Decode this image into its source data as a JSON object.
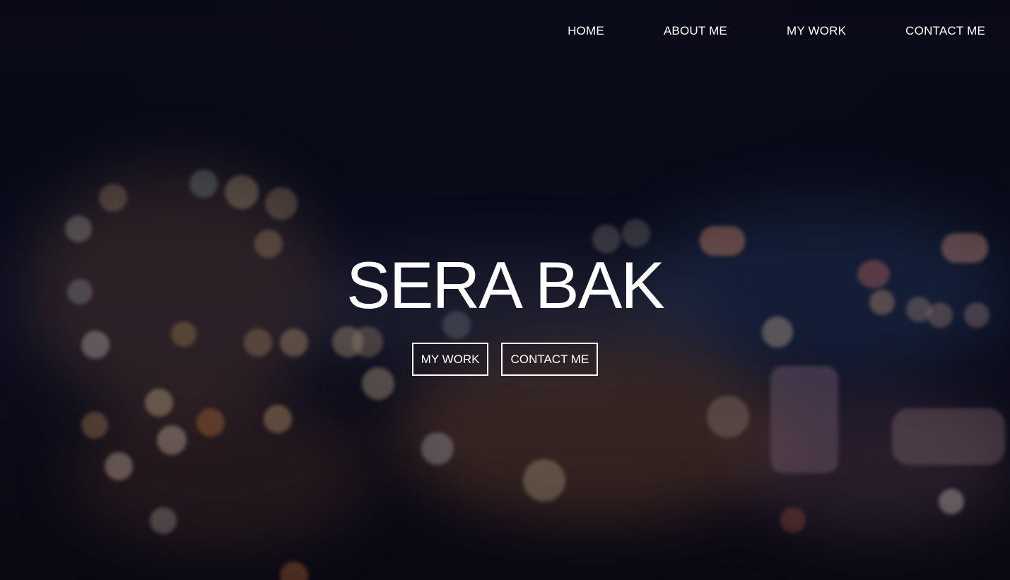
{
  "nav": {
    "items": [
      {
        "label": "HOME"
      },
      {
        "label": "ABOUT ME"
      },
      {
        "label": "MY WORK"
      },
      {
        "label": "CONTACT ME"
      }
    ]
  },
  "hero": {
    "title": "SERA BAK",
    "buttons": [
      {
        "label": "MY WORK"
      },
      {
        "label": "CONTACT ME"
      }
    ],
    "background_image": "blurred city night lights bokeh",
    "colors": {
      "background": "#0a0b18",
      "text": "#ffffff"
    }
  }
}
